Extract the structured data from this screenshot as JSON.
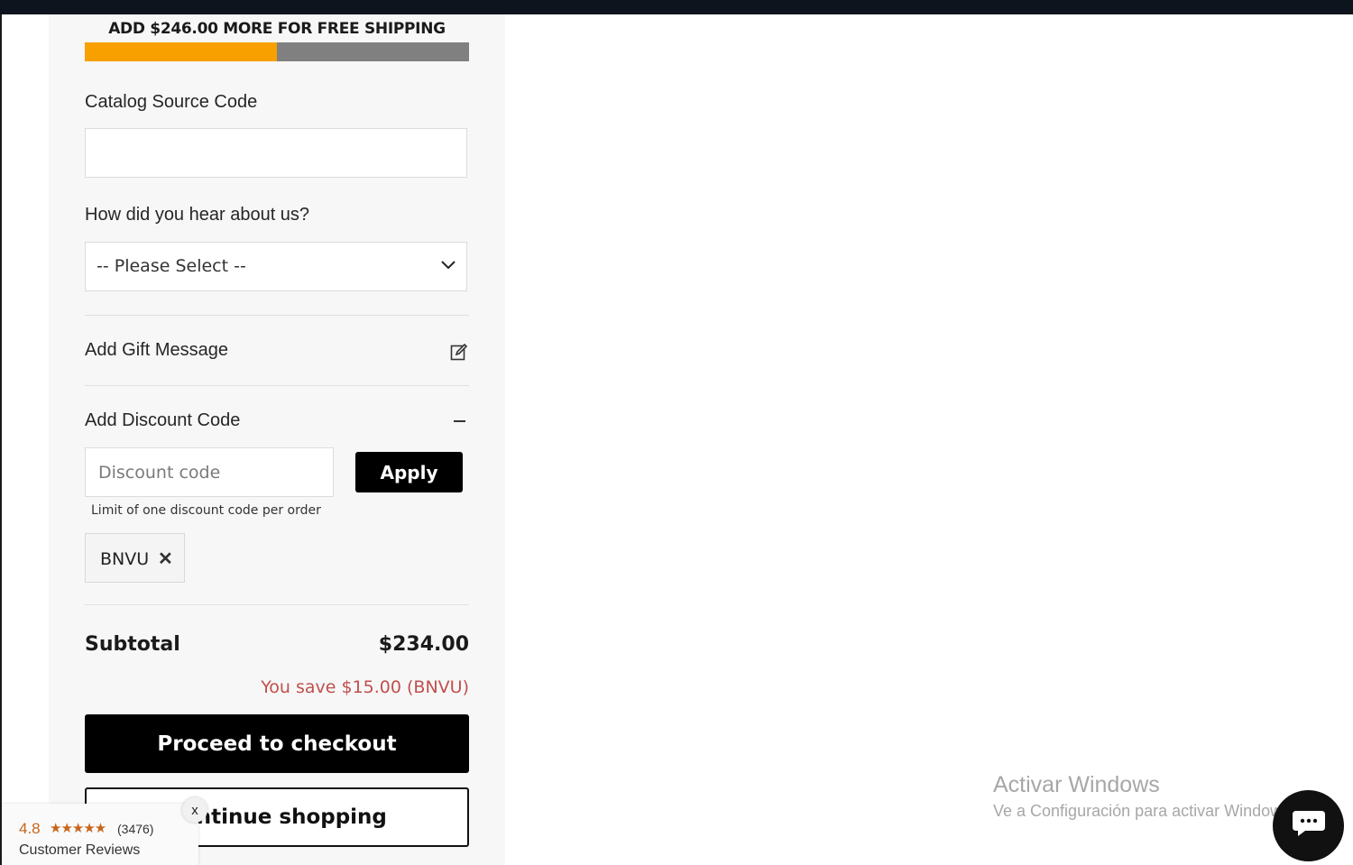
{
  "shipping_banner": {
    "text": "ADD $246.00 MORE FOR FREE SHIPPING",
    "progress_fraction": 0.5,
    "fill_color": "#f7a000",
    "track_color": "#808080"
  },
  "form": {
    "catalog_label": "Catalog Source Code",
    "catalog_value": "",
    "hear_label": "How did you hear about us?",
    "hear_selected": "-- Please Select --"
  },
  "gift": {
    "label": "Add Gift Message",
    "icon": "edit-icon"
  },
  "discount": {
    "label": "Add Discount Code",
    "toggle_icon": "minus-icon",
    "placeholder": "Discount code",
    "apply_label": "Apply",
    "limit_note": "Limit of one discount code per order",
    "applied_code": "BNVU",
    "remove_symbol": "✕"
  },
  "summary": {
    "subtotal_label": "Subtotal",
    "subtotal_value": "$234.00",
    "savings_text": "You save $15.00 (BNVU)",
    "savings_color": "#c0504d"
  },
  "actions": {
    "checkout_label": "Proceed to checkout",
    "continue_label": "Continue shopping"
  },
  "reviews_widget": {
    "rating": "4.8",
    "stars": "★★★★★",
    "count": "(3476)",
    "label": "Customer Reviews",
    "close_label": "x"
  },
  "windows_watermark": {
    "title": "Activar Windows",
    "subtitle": "Ve a Configuración para activar Windows."
  },
  "chat": {
    "icon": "chat-bubble-icon"
  }
}
